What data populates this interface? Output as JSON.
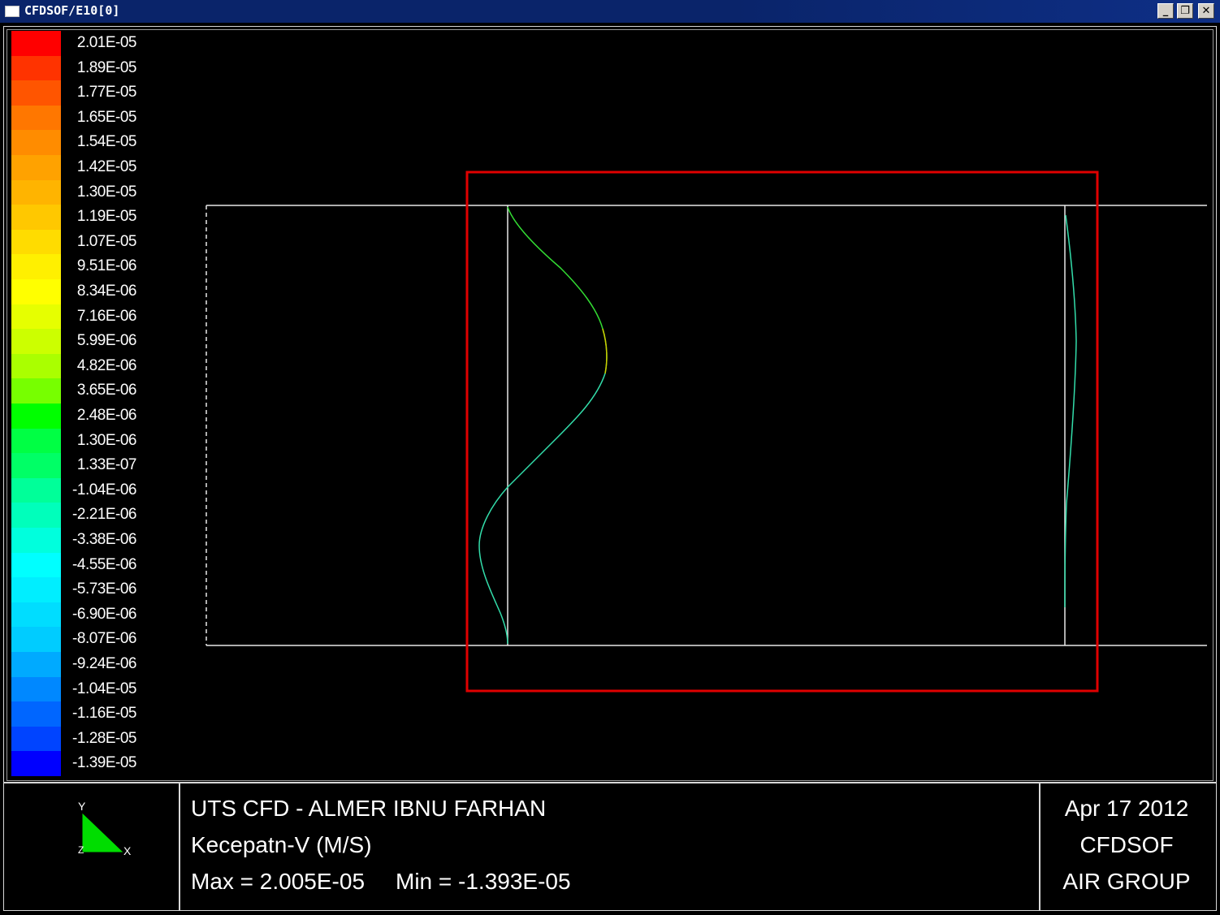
{
  "window": {
    "title": "CFDSOF/E10[0]",
    "controls": {
      "minimize": "_",
      "restore": "❐",
      "close": "✕"
    }
  },
  "legend": {
    "entries": [
      {
        "label": "2.01E-05",
        "color": "#ff0000"
      },
      {
        "label": "1.89E-05",
        "color": "#ff3300"
      },
      {
        "label": "1.77E-05",
        "color": "#ff5500"
      },
      {
        "label": "1.65E-05",
        "color": "#ff7700"
      },
      {
        "label": "1.54E-05",
        "color": "#ff8c00"
      },
      {
        "label": "1.42E-05",
        "color": "#ffa200"
      },
      {
        "label": "1.30E-05",
        "color": "#ffb400"
      },
      {
        "label": "1.19E-05",
        "color": "#ffc800"
      },
      {
        "label": "1.07E-05",
        "color": "#ffdc00"
      },
      {
        "label": "9.51E-06",
        "color": "#fff000"
      },
      {
        "label": "8.34E-06",
        "color": "#ffff00"
      },
      {
        "label": "7.16E-06",
        "color": "#e6ff00"
      },
      {
        "label": "5.99E-06",
        "color": "#ccff00"
      },
      {
        "label": "4.82E-06",
        "color": "#aaff00"
      },
      {
        "label": "3.65E-06",
        "color": "#77ff00"
      },
      {
        "label": "2.48E-06",
        "color": "#00ff00"
      },
      {
        "label": "1.30E-06",
        "color": "#00ff44"
      },
      {
        "label": "1.33E-07",
        "color": "#00ff66"
      },
      {
        "label": "-1.04E-06",
        "color": "#00ff99"
      },
      {
        "label": "-2.21E-06",
        "color": "#00ffbb"
      },
      {
        "label": "-3.38E-06",
        "color": "#00ffdd"
      },
      {
        "label": "-4.55E-06",
        "color": "#00ffff"
      },
      {
        "label": "-5.73E-06",
        "color": "#00eeff"
      },
      {
        "label": "-6.90E-06",
        "color": "#00ddff"
      },
      {
        "label": "-8.07E-06",
        "color": "#00ccff"
      },
      {
        "label": "-9.24E-06",
        "color": "#00aaff"
      },
      {
        "label": "-1.04E-05",
        "color": "#0088ff"
      },
      {
        "label": "-1.16E-05",
        "color": "#0066ff"
      },
      {
        "label": "-1.28E-05",
        "color": "#0044ff"
      },
      {
        "label": "-1.39E-05",
        "color": "#0000ff"
      }
    ]
  },
  "plot": {
    "highlight_color": "#e00000",
    "profile_colors": {
      "green": "#33dd33",
      "yellow": "#cccc00",
      "cyan": "#33ddaa",
      "outline": "#e8e8e8"
    }
  },
  "axis_triad": {
    "y_label": "Y",
    "x_label": "X",
    "z_label": "Z",
    "color": "#00dd00"
  },
  "info": {
    "title": "UTS CFD - ALMER IBNU FARHAN",
    "quantity": "Kecepatn-V (M/S)",
    "max": "Max = 2.005E-05",
    "min": "Min = -1.393E-05",
    "date": "Apr 17 2012",
    "software": "CFDSOF",
    "group": "AIR GROUP"
  }
}
